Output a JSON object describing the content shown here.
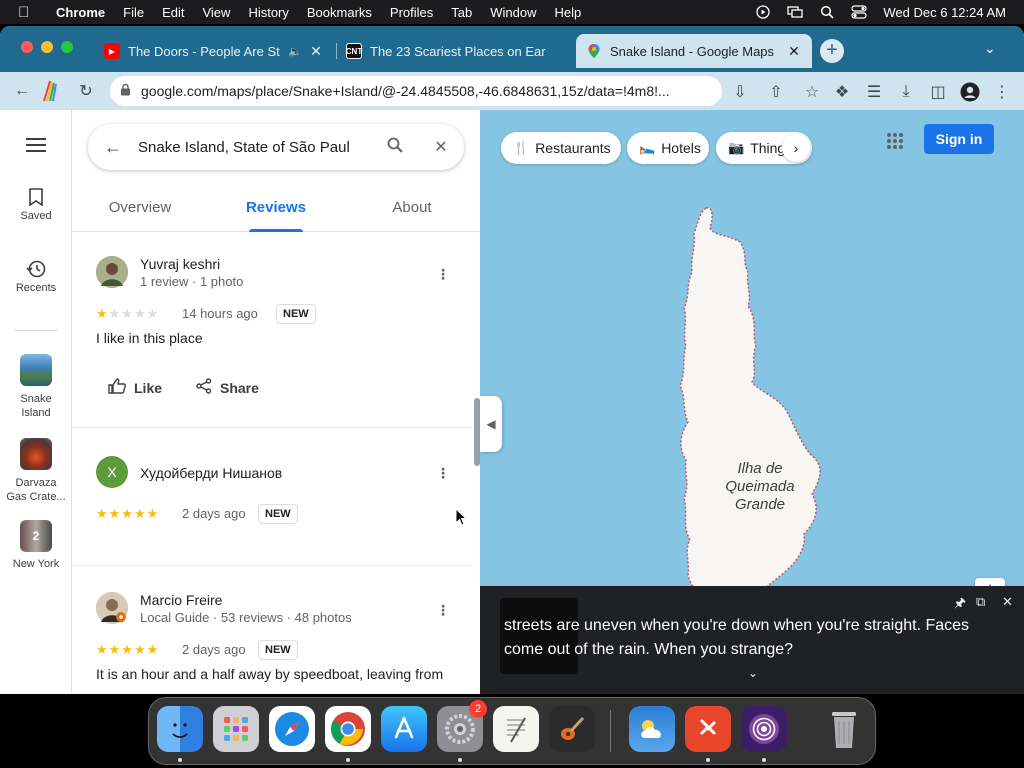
{
  "menubar": {
    "app": "Chrome",
    "items": [
      "File",
      "Edit",
      "View",
      "History",
      "Bookmarks",
      "Profiles",
      "Tab",
      "Window",
      "Help"
    ],
    "clock": "Wed Dec 6  12:24 AM"
  },
  "browser": {
    "tabs": [
      {
        "title": "The Doors - People Are St",
        "favicon": "youtube-icon",
        "favicon_color": "#ff0000"
      },
      {
        "title": "The 23 Scariest Places on Ear",
        "favicon": "cnt-icon",
        "favicon_text": "CNT"
      },
      {
        "title": "Snake Island - Google Maps",
        "favicon": "google-maps-icon"
      }
    ],
    "url": "google.com/maps/place/Snake+Island/@-24.4845508,-46.6848631,15z/data=!4m8!..."
  },
  "rail": {
    "items": [
      {
        "label": "Saved"
      },
      {
        "label": "Recents"
      },
      {
        "label": "Snake Island"
      },
      {
        "label": "Darvaza Gas Crate..."
      },
      {
        "label": "New York",
        "count": "2"
      }
    ]
  },
  "search": {
    "query": "Snake Island, State of São Paul"
  },
  "place_tabs": [
    {
      "label": "Overview"
    },
    {
      "label": "Reviews"
    },
    {
      "label": "About"
    }
  ],
  "reviews": [
    {
      "name": "Yuvraj keshri",
      "meta": "1 review · 1 photo",
      "rating": 1,
      "time": "14 hours ago",
      "badge": "NEW",
      "text": "I like in this place",
      "like_label": "Like",
      "share_label": "Share"
    },
    {
      "name": "Худойберди Нишанов",
      "initial": "Х",
      "rating": 5,
      "time": "2 days ago",
      "badge": "NEW"
    },
    {
      "name": "Marcio Freire",
      "meta": "Local Guide · 53 reviews · 48 photos",
      "rating": 5,
      "time": "2 days ago",
      "badge": "NEW",
      "text": "It is an hour and a half away by speedboat, leaving from"
    }
  ],
  "map": {
    "chips": [
      {
        "label": "Restaurants",
        "icon": "fork-knife-icon"
      },
      {
        "label": "Hotels",
        "icon": "bed-icon"
      },
      {
        "label": "Things",
        "icon": "camera-icon"
      }
    ],
    "signin_label": "Sign in",
    "island_label": [
      "Ilha de",
      "Queimada",
      "Grande"
    ],
    "water_color": "#85c5e3",
    "land_color": "#f8f6f2"
  },
  "caption": {
    "text": "streets are uneven when you're down when you're straight. Faces come out of the rain. When you strange?"
  },
  "dock": {
    "apps": [
      "finder",
      "launchpad",
      "safari",
      "chrome",
      "app-store",
      "system-settings",
      "textedit",
      "garageband",
      "weather",
      "remote-desktop",
      "tor-browser",
      "trash"
    ],
    "settings_badge": "2"
  },
  "colors": {
    "accent": "#1a73e8",
    "tabstrip": "#1f6a8e",
    "toolbar": "#cfe4ef",
    "star": "#fbbc04"
  }
}
